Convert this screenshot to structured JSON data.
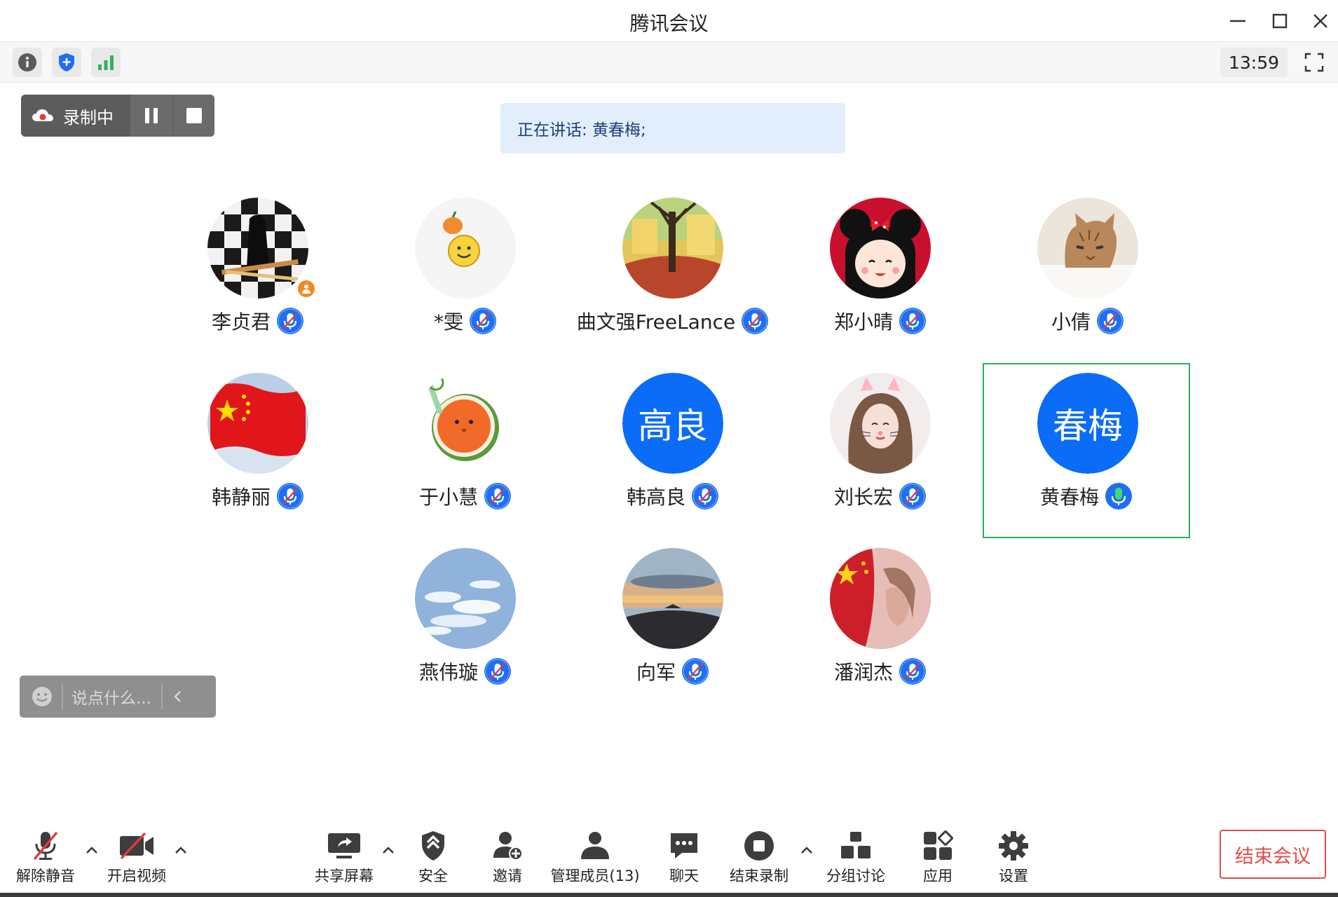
{
  "window": {
    "title": "腾讯会议",
    "controls": [
      "minimize-icon",
      "maximize-icon",
      "close-icon"
    ]
  },
  "toolstrip": {
    "icons": [
      "info-icon",
      "shield-icon",
      "signal-icon"
    ],
    "clock": "13:59"
  },
  "recording": {
    "label": "录制中"
  },
  "speaking": {
    "text": "正在讲话: 黄春梅;"
  },
  "participants": [
    {
      "name": "李贞君",
      "avatar": "checker-bird",
      "mic": "muted",
      "host": true
    },
    {
      "name": "*雯",
      "avatar": "smiley",
      "mic": "muted"
    },
    {
      "name": "曲文强FreeLance",
      "avatar": "park-tree",
      "mic": "muted"
    },
    {
      "name": "郑小晴",
      "avatar": "cartoon-girl",
      "mic": "muted"
    },
    {
      "name": "小倩",
      "avatar": "cat",
      "mic": "muted"
    },
    {
      "name": "韩静丽",
      "avatar": "flag",
      "mic": "muted"
    },
    {
      "name": "于小慧",
      "avatar": "orange-bird",
      "mic": "muted"
    },
    {
      "name": "韩高良",
      "avatar": "text",
      "avatar_text": "高良",
      "mic": "muted"
    },
    {
      "name": "刘长宏",
      "avatar": "photo-girl",
      "mic": "muted"
    },
    {
      "name": "黄春梅",
      "avatar": "text",
      "avatar_text": "春梅",
      "mic": "active",
      "speaking": true
    },
    {
      "name": "燕伟璇",
      "avatar": "sky",
      "mic": "muted"
    },
    {
      "name": "向军",
      "avatar": "sunset",
      "mic": "muted"
    },
    {
      "name": "潘润杰",
      "avatar": "flag-portrait",
      "mic": "muted"
    }
  ],
  "chat": {
    "placeholder": "说点什么..."
  },
  "toolbar": {
    "unmute": "解除静音",
    "video": "开启视频",
    "share": "共享屏幕",
    "security": "安全",
    "invite": "邀请",
    "members": "管理成员(13)",
    "chat": "聊天",
    "end_record": "结束录制",
    "breakout": "分组讨论",
    "apps": "应用",
    "settings": "设置",
    "end_meeting": "结束会议"
  },
  "colors": {
    "brand_blue": "#0a6cf7",
    "mic_muted_blue": "#1f6ff0",
    "mic_active_green": "#2fb45a",
    "danger_red": "#e44b4b",
    "speaking_border": "#27b15f"
  }
}
